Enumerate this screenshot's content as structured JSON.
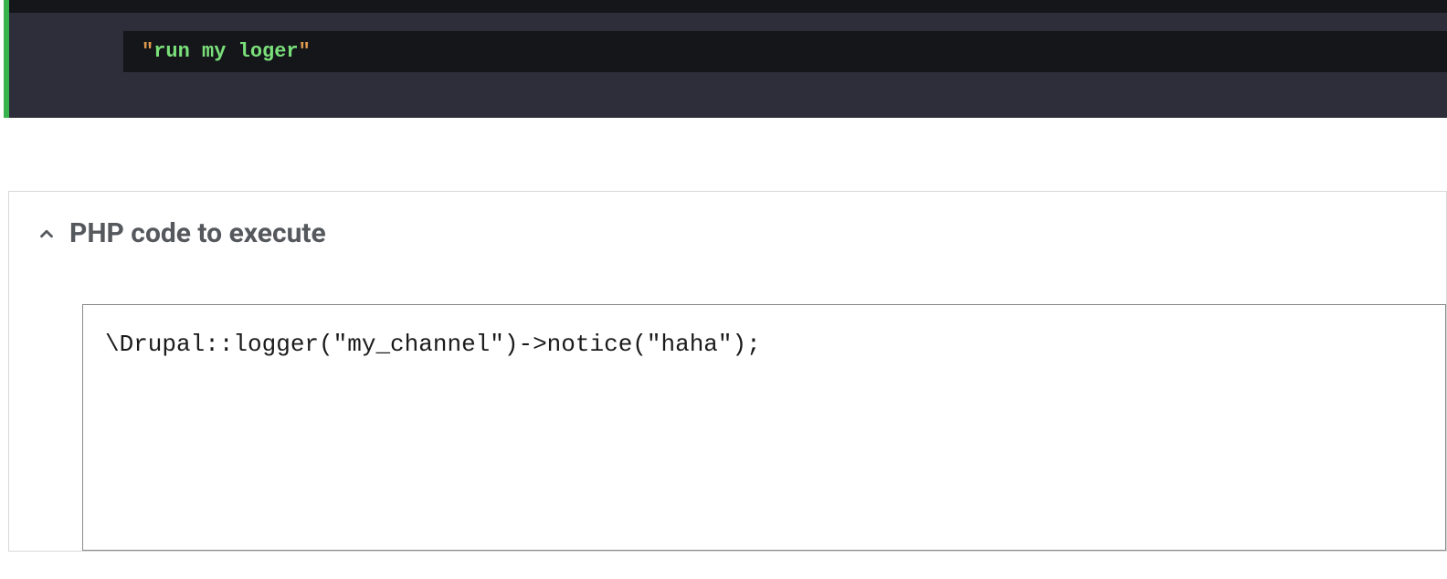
{
  "dark_block": {
    "string_value": "run my loger"
  },
  "section": {
    "title": "PHP code to execute",
    "php_code": "\\Drupal::logger(\"my_channel\")->notice(\"haha\");"
  }
}
